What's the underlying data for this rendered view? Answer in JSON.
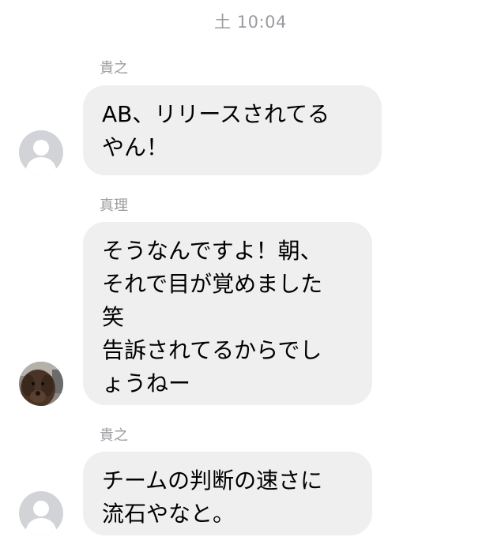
{
  "timestamp": "土 10:04",
  "messages": [
    {
      "sender": "貴之",
      "text": "AB、リリースされてる\nやん！",
      "avatar": "default-person-icon"
    },
    {
      "sender": "真理",
      "text": "そうなんですよ！朝、\nそれで目が覚めました\n笑\n告訴されてるからでし\nょうねー",
      "avatar": "dog-photo"
    },
    {
      "sender": "貴之",
      "text": "チームの判断の速さに\n流石やなと。",
      "avatar": "default-person-icon"
    }
  ],
  "colors": {
    "bubble": "#efefef",
    "meta_text": "#9a9a9f",
    "avatar_placeholder": "#cfd0d4"
  }
}
